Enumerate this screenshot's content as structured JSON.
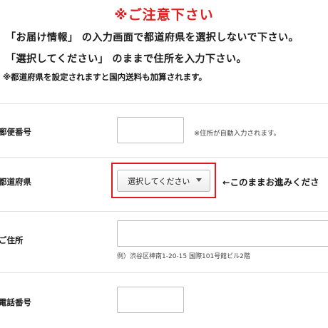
{
  "notice": {
    "title": "※ご注意下さい",
    "line1": "「お届け情報」 の入力画面で都道府県を選択しないで下さい。",
    "line2": "「選択してください」 のままで住所を入力下さい。",
    "line3": "※都道府県を設定されますと国内送料も加算されます。"
  },
  "form": {
    "postal_label": "郵便番号",
    "postal_hint": "※住所が自動入力されます。",
    "prefecture_label": "都道府県",
    "prefecture_select": "選択してください",
    "prefecture_note": "←このままお進みくださ",
    "address_label": "ご住所",
    "address_example": "例）渋谷区神南1-20-15 国際101号館ビル2階",
    "phone_label": "電話番号"
  },
  "colors": {
    "accent_red": "#e02020"
  }
}
